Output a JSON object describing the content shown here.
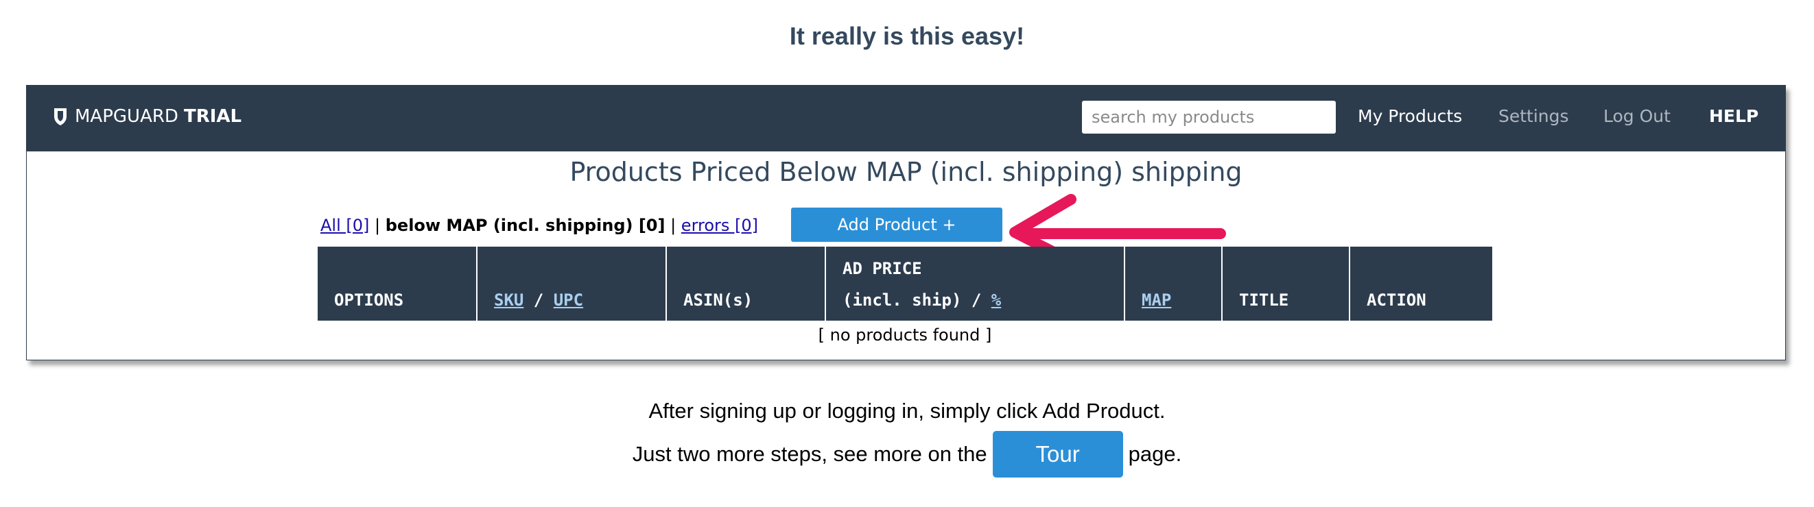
{
  "headline": "It really is this easy!",
  "navbar": {
    "brand_name": "MAPGUARD",
    "brand_suffix": "TRIAL",
    "search_placeholder": "search my products",
    "links": {
      "my_products": "My Products",
      "settings": "Settings",
      "log_out": "Log Out",
      "help": "HELP"
    }
  },
  "page_title": "Products Priced Below MAP (incl. shipping) shipping",
  "filters": {
    "all": "All [0]",
    "separator": " | ",
    "below_map": "below MAP (incl. shipping) [0]",
    "errors": "errors [0]"
  },
  "add_product_label": "Add Product +",
  "table": {
    "options": "OPTIONS",
    "sku": "SKU",
    "slash": " / ",
    "upc": "UPC",
    "asin": "ASIN(s)",
    "ad_price_line1": "AD PRICE",
    "ad_price_line2": "(incl. ship) / ",
    "percent": "%",
    "map": "MAP",
    "title": "TITLE",
    "action": "ACTION",
    "empty": "[ no products found ]"
  },
  "footer": {
    "line1": "After signing up or logging in, simply click Add Product.",
    "line2_before": "Just two more steps, see more on the",
    "tour_label": "Tour",
    "line2_after": "page."
  },
  "colors": {
    "navbar_bg": "#2d3c4d",
    "accent_blue": "#2b8fd8",
    "arrow_pink": "#e6185a"
  },
  "icons": {
    "brand": "shield-icon",
    "annotation": "arrow-left-icon"
  }
}
